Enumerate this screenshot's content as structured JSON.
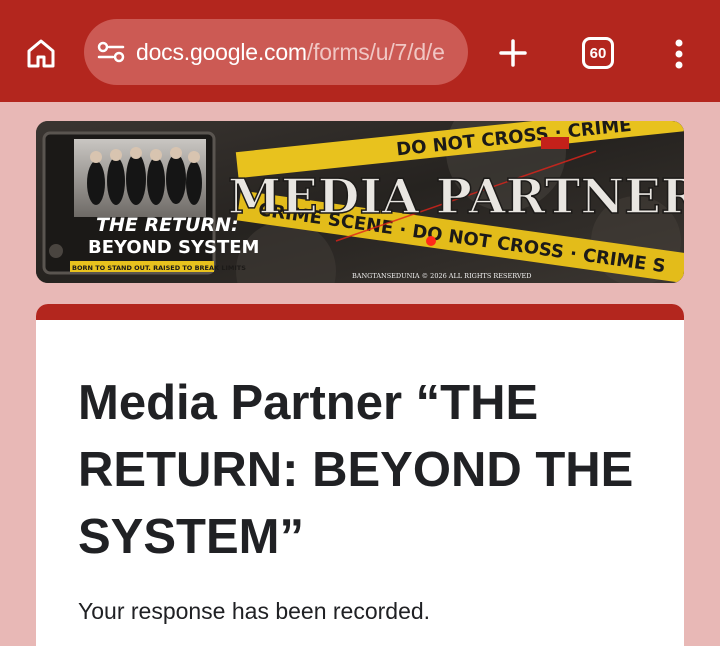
{
  "browser": {
    "url_host": "docs.google.com",
    "url_path": "/forms/u/7/d/e",
    "tab_count": "60",
    "icons": {
      "home": "home-icon",
      "site_info": "tune-icon",
      "new_tab": "plus-icon",
      "menu": "more-vert-icon"
    },
    "theme_color": "#b3261e"
  },
  "banner": {
    "headline": "MEDIA PARTNER",
    "logo_line1": "THE RETURN:",
    "logo_line2": "BEYOND SYSTEM",
    "tagline": "BORN TO STAND OUT. RAISED TO BREAK LIMITS",
    "copyright": "BANGTANSEDUNIA © 2026 ALL RIGHTS RESERVED",
    "tape_text_1": "DO NOT CROSS · CRIME",
    "tape_text_2": "CRIME SCENE · DO NOT CROSS · CRIME S"
  },
  "form": {
    "title": "Media Partner “THE RETURN: BEYOND THE SYSTEM”",
    "confirmation": "Your response has been recorded.",
    "accent_color": "#b3261e"
  }
}
